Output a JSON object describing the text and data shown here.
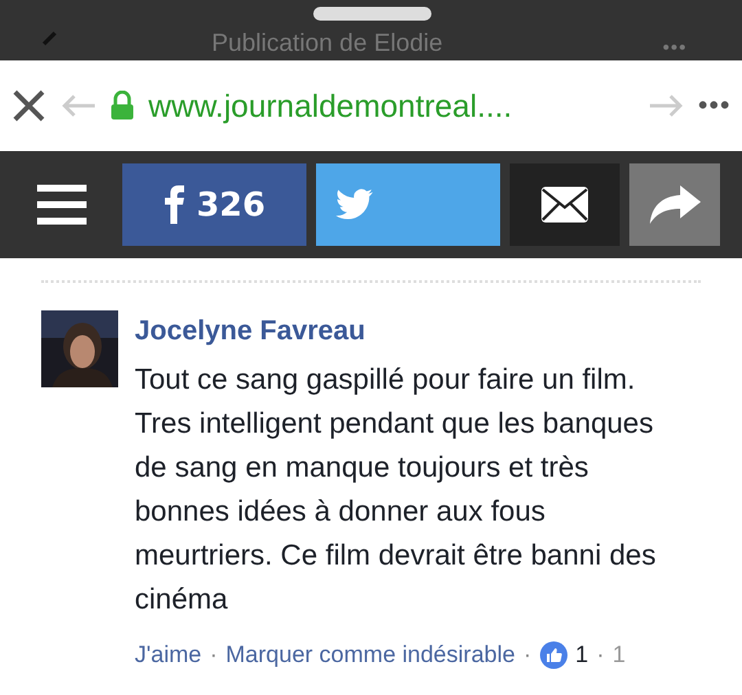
{
  "app_bar": {
    "title": "Publication de Elodie",
    "more": "•••"
  },
  "browser_bar": {
    "url": "www.journaldemontreal....",
    "more": "•••"
  },
  "share_bar": {
    "facebook_count": "326"
  },
  "comment": {
    "author": "Jocelyne Favreau",
    "separator": "·",
    "text": "Tout ce sang gaspillé pour faire un film. Tres intelligent pendant que les banques de sang en manque toujours et très bonnes idées à donner aux fous meurtriers. Ce film devrait être banni des cinéma",
    "actions": [
      {
        "kind": "link",
        "label": "J'aime"
      },
      {
        "kind": "link",
        "label": "Marquer comme indésirable"
      },
      {
        "kind": "likes",
        "label": "1"
      },
      {
        "kind": "plain",
        "label": "1"
      }
    ]
  }
}
